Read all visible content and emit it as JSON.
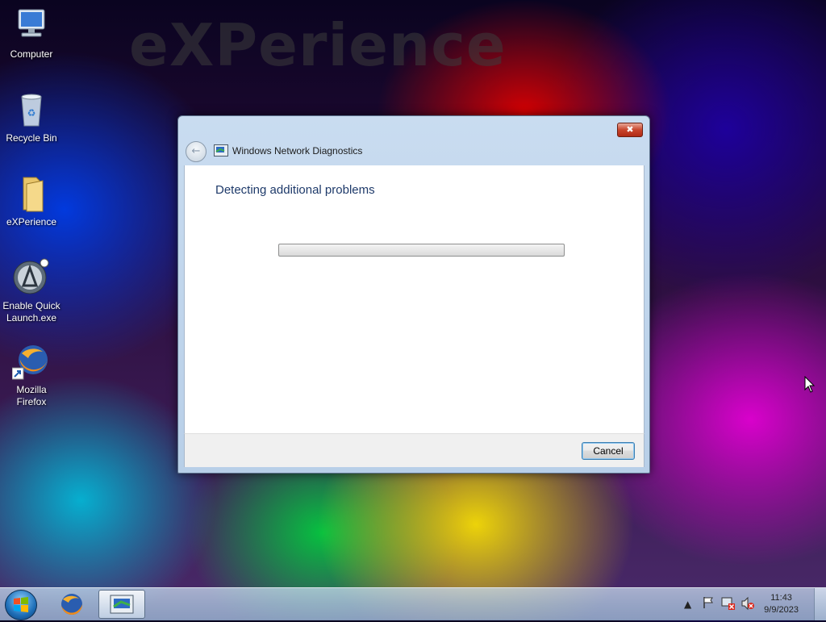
{
  "desktop": {
    "watermark": "eXPerience",
    "icons": [
      {
        "label": "Computer"
      },
      {
        "label": "Recycle Bin"
      },
      {
        "label": "eXPerience"
      },
      {
        "label": "Enable Quick Launch.exe"
      },
      {
        "label": "Mozilla Firefox"
      }
    ]
  },
  "window": {
    "title": "Windows Network Diagnostics",
    "heading": "Detecting additional problems",
    "progress": 0.0,
    "cancel_label": "Cancel"
  },
  "taskbar": {
    "clock_time": "11:43",
    "clock_date": "9/9/2023"
  }
}
